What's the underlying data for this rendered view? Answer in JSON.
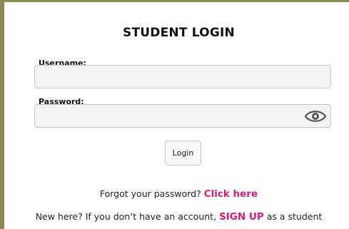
{
  "login": {
    "title": "STUDENT LOGIN",
    "username_label": "Username:",
    "username_value": "",
    "password_label": "Password:",
    "password_value": "",
    "show_password_icon": "eye-icon",
    "login_button": "Login"
  },
  "forgot": {
    "text": "Forgot your password?",
    "link": "Click here"
  },
  "signup": {
    "prefix": "New here? If you don’t have an account,",
    "link": "SIGN UP",
    "suffix": "as a student"
  },
  "colors": {
    "link": "#d81b7a",
    "frame_border": "#8a8a55",
    "field_background": "#f3f3f3"
  }
}
